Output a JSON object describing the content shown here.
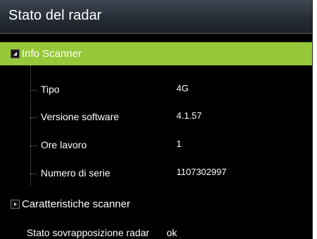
{
  "window": {
    "title": "Stato del radar"
  },
  "sections": [
    {
      "label": "Info Scanner",
      "expanded": true,
      "rows": [
        {
          "key": "Tipo",
          "value": "4G"
        },
        {
          "key": "Versione software",
          "value": "4.1.57"
        },
        {
          "key": "Ore lavoro",
          "value": "1"
        },
        {
          "key": "Numero di serie",
          "value": "1107302997"
        }
      ]
    },
    {
      "label": "Caratteristiche scanner",
      "expanded": false
    }
  ],
  "footer_row": {
    "key": "Stato sovrapposizione radar",
    "value": "ok"
  },
  "colors": {
    "accent": "#97c83a",
    "background": "#000000",
    "text": "#ffffff"
  },
  "icons": {
    "expanded": "triangle-down-icon",
    "collapsed": "triangle-right-icon"
  }
}
